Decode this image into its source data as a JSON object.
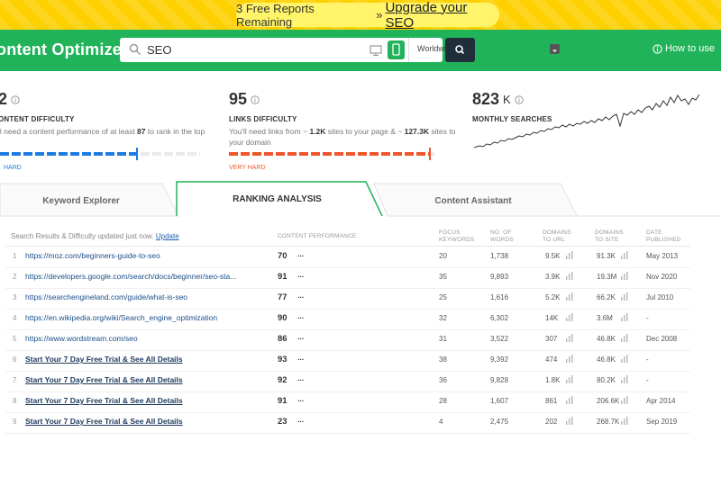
{
  "promo": {
    "text": "3 Free Reports Remaining",
    "arrow": "»",
    "link": "Upgrade your SEO"
  },
  "header": {
    "title": "ontent Optimizer",
    "search_value": "SEO",
    "location": "Worldwide",
    "how_to": "How to use"
  },
  "metrics": {
    "content_difficulty": {
      "value": "2",
      "label": "ONTENT DIFFICULTY",
      "desc_pre": "ll need a content performance of at least ",
      "desc_num": "87",
      "desc_post": " to rank in the top",
      "level_text": "HARD",
      "level": 0.87,
      "color": "#1e7be0"
    },
    "links_difficulty": {
      "value": "95",
      "label": "LINKS DIFFICULTY",
      "desc_pre": "You'll need links from ~ ",
      "desc_num1": "1.2K",
      "desc_mid": " sites to your page & ~ ",
      "desc_num2": "127.3K",
      "desc_post": " sites to your domain",
      "level_text": "VERY HARD",
      "level": 0.95,
      "color": "#f0562d"
    },
    "monthly_searches": {
      "value": "823",
      "unit": "K",
      "label": "MONTHLY SEARCHES"
    }
  },
  "tabs": [
    {
      "label": "Keyword Explorer"
    },
    {
      "label": "RANKING ANALYSIS"
    },
    {
      "label": "Content Assistant"
    }
  ],
  "table": {
    "status_text": "Search Results & Difficulty updated just now.",
    "status_link": "Update",
    "columns": {
      "content_performance": "CONTENT PERFORMANCE",
      "focus_keywords": "FOCUS KEYWORDS",
      "words": "NO. OF WORDS",
      "domains_url": "DOMAINS TO URL",
      "domains_site": "DOMAINS TO SITE",
      "date": "DATE PUBLISHED"
    },
    "rows": [
      {
        "n": "1",
        "url": "https://moz.com/beginners-guide-to-seo",
        "cp": "70",
        "dots": "...",
        "fk": "20",
        "words": "1,738",
        "durl": "9.5K",
        "dsite": "91.3K",
        "date": "May 2013",
        "trial": false
      },
      {
        "n": "2",
        "url": "https://developers.google.com/search/docs/beginner/seo-sta...",
        "cp": "91",
        "dots": "...",
        "fk": "35",
        "words": "9,893",
        "durl": "3.9K",
        "dsite": "19.3M",
        "date": "Nov 2020",
        "trial": false
      },
      {
        "n": "3",
        "url": "https://searchengineland.com/guide/what-is-seo",
        "cp": "77",
        "dots": "...",
        "fk": "25",
        "words": "1,616",
        "durl": "5.2K",
        "dsite": "66.2K",
        "date": "Jul 2010",
        "trial": false
      },
      {
        "n": "4",
        "url": "https://en.wikipedia.org/wiki/Search_engine_optimization",
        "cp": "90",
        "dots": "...",
        "fk": "32",
        "words": "6,302",
        "durl": "14K",
        "dsite": "3.6M",
        "date": "-",
        "trial": false
      },
      {
        "n": "5",
        "url": "https://www.wordstream.com/seo",
        "cp": "86",
        "dots": "...",
        "fk": "31",
        "words": "3,522",
        "durl": "307",
        "dsite": "46.8K",
        "date": "Dec 2008",
        "trial": false
      },
      {
        "n": "6",
        "url": "Start Your 7 Day Free Trial & See All Details",
        "cp": "93",
        "dots": "...",
        "fk": "38",
        "words": "9,392",
        "durl": "474",
        "dsite": "46.8K",
        "date": "-",
        "trial": true
      },
      {
        "n": "7",
        "url": "Start Your 7 Day Free Trial & See All Details",
        "cp": "92",
        "dots": "...",
        "fk": "36",
        "words": "9,828",
        "durl": "1.8K",
        "dsite": "80.2K",
        "date": "-",
        "trial": true
      },
      {
        "n": "8",
        "url": "Start Your 7 Day Free Trial & See All Details",
        "cp": "91",
        "dots": "...",
        "fk": "28",
        "words": "1,607",
        "durl": "861",
        "dsite": "206.6K",
        "date": "Apr 2014",
        "trial": true
      },
      {
        "n": "9",
        "url": "Start Your 7 Day Free Trial & See All Details",
        "cp": "23",
        "dots": "...",
        "fk": "4",
        "words": "2,475",
        "durl": "202",
        "dsite": "268.7K",
        "date": "Sep 2019",
        "trial": true
      }
    ]
  }
}
